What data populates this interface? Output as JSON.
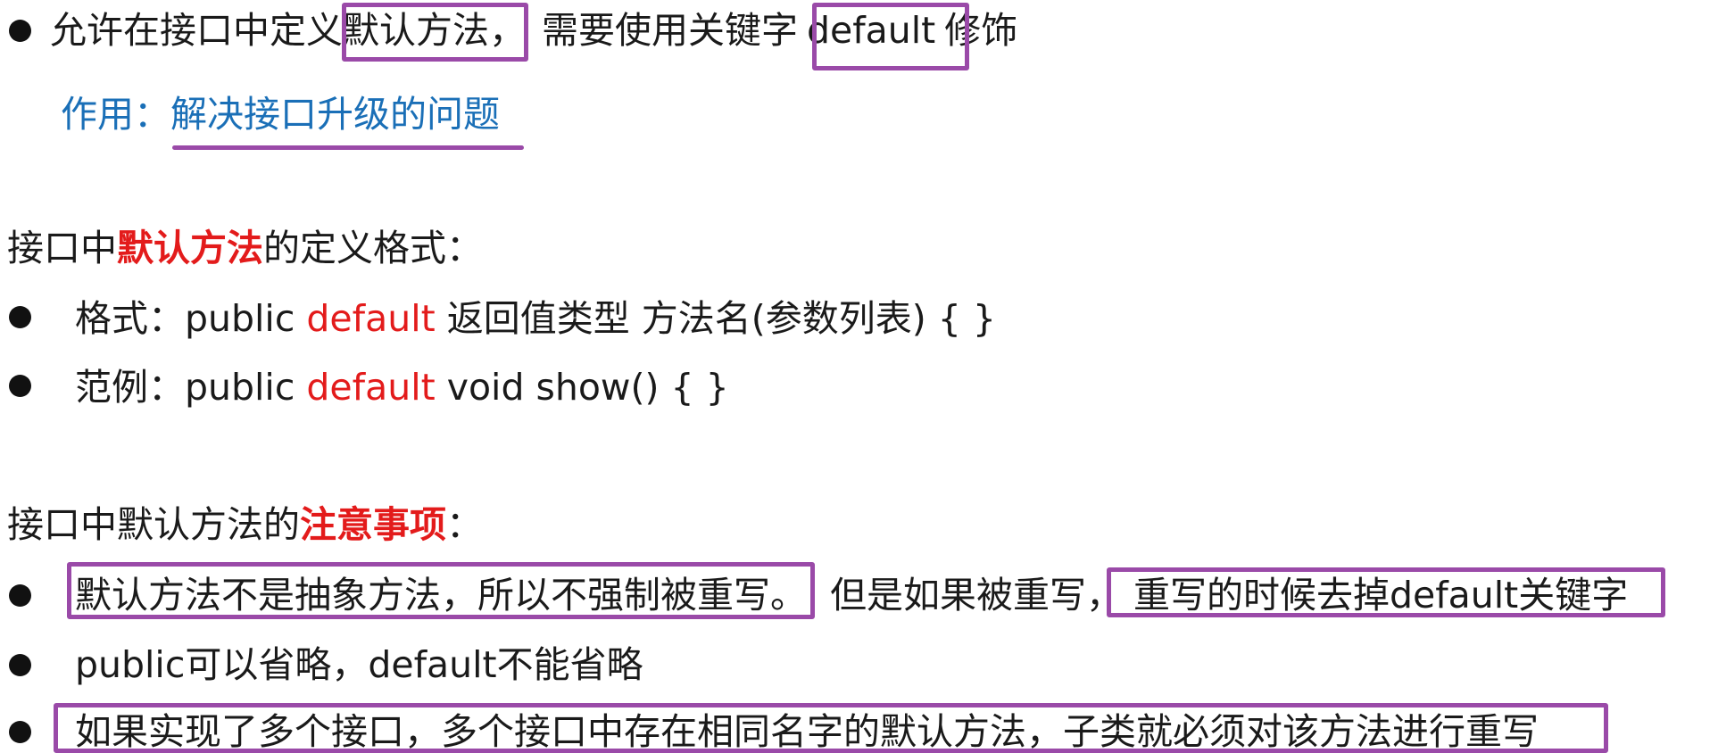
{
  "line1": {
    "prefix": "允许在接口中定义",
    "default_method": "默认方法",
    "comma": "，",
    "middle": "需要使用关键字",
    "keyword": "default",
    "suffix": "修饰"
  },
  "purpose": {
    "label": "作用：",
    "text": "解决接口升级的问题"
  },
  "format_heading": {
    "prefix": "接口中",
    "highlight": "默认方法",
    "suffix": "的定义格式："
  },
  "format_items": [
    {
      "label": "格式：",
      "pre": "public ",
      "kw": "default",
      "post": " 返回值类型 方法名(参数列表) {   }"
    },
    {
      "label": "范例：",
      "pre": "public ",
      "kw": "default",
      "post": " void show() {   }"
    }
  ],
  "notes_heading": {
    "prefix": "接口中默认方法的",
    "highlight": "注意事项",
    "suffix": "："
  },
  "notes": {
    "item1_a": "默认方法不是抽象方法，所以不强制被重写。",
    "item1_b": "但是如果被重写，",
    "item1_c": "重写的时候去掉default关键字",
    "item2": "public可以省略，default不能省略",
    "item3": "如果实现了多个接口，多个接口中存在相同名字的默认方法，子类就必须对该方法进行重写"
  },
  "colors": {
    "highlight_red": "#e31b1b",
    "purpose_blue": "#1a6fb7",
    "annotation_purple": "#9a4aa8"
  }
}
